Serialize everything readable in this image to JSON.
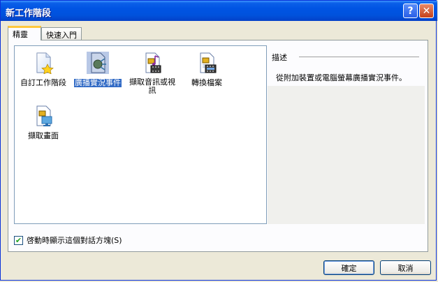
{
  "window": {
    "title": "新工作階段"
  },
  "titlebar": {
    "help_glyph": "?",
    "close_glyph": "✕"
  },
  "tabs": [
    {
      "label": "精靈",
      "active": true
    },
    {
      "label": "快速入門",
      "active": false
    }
  ],
  "items": [
    {
      "label": "自訂工作階段",
      "icon": "custom-session-icon",
      "selected": false
    },
    {
      "label": "廣播實況事件",
      "icon": "broadcast-live-icon",
      "selected": true
    },
    {
      "label": "擷取音訊或視訊",
      "icon": "capture-audio-video-icon",
      "selected": false
    },
    {
      "label": "轉換檔案",
      "icon": "convert-file-icon",
      "selected": false
    },
    {
      "label": "擷取畫面",
      "icon": "capture-screen-icon",
      "selected": false
    }
  ],
  "description": {
    "heading": "描述",
    "text": "從附加裝置或電腦螢幕廣播實況事件。"
  },
  "startup_checkbox": {
    "label": "啓動時顯示這個對話方塊(S)",
    "checked": true,
    "mark": "✔"
  },
  "buttons": {
    "ok": "確定",
    "cancel": "取消"
  },
  "colors": {
    "accent": "#0054e3",
    "selection": "#316ac5"
  }
}
